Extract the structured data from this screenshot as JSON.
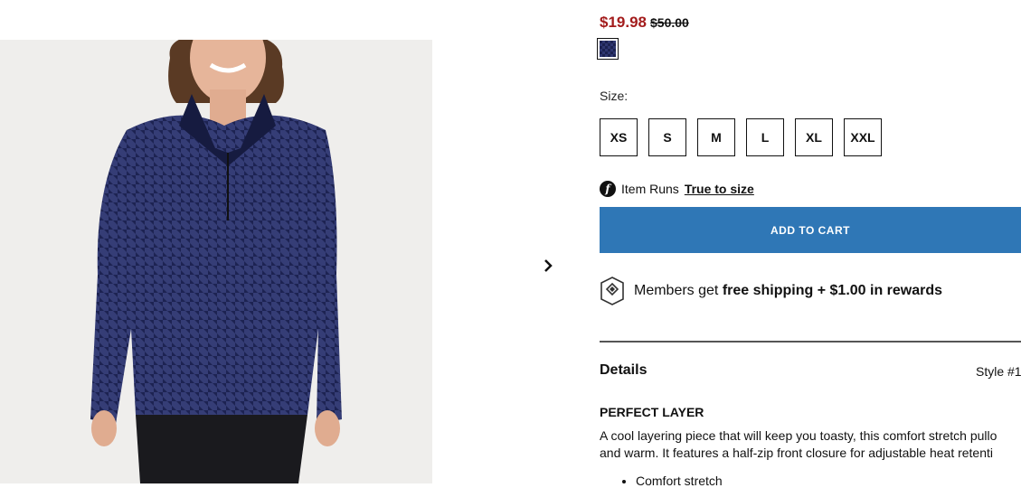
{
  "product": {
    "sale_price": "$19.98",
    "original_price": "$50.00",
    "swatch_color": "#1c2250",
    "size_label": "Size:",
    "sizes": [
      "XS",
      "S",
      "M",
      "L",
      "XL",
      "XXL"
    ],
    "fit_prefix": "Item Runs",
    "fit_value": "True to size",
    "add_to_cart": "ADD TO CART",
    "accent_color": "#2f77b6"
  },
  "members": {
    "prefix": "Members get",
    "bold": "free shipping + $1.00 in rewards"
  },
  "details": {
    "title": "Details",
    "style": "Style #1",
    "heading": "PERFECT LAYER",
    "line1": "A cool layering piece that will keep you toasty, this comfort stretch pullo",
    "line2": "and warm. It features a half-zip front closure for adjustable heat retenti",
    "bullet1": "Comfort stretch"
  }
}
